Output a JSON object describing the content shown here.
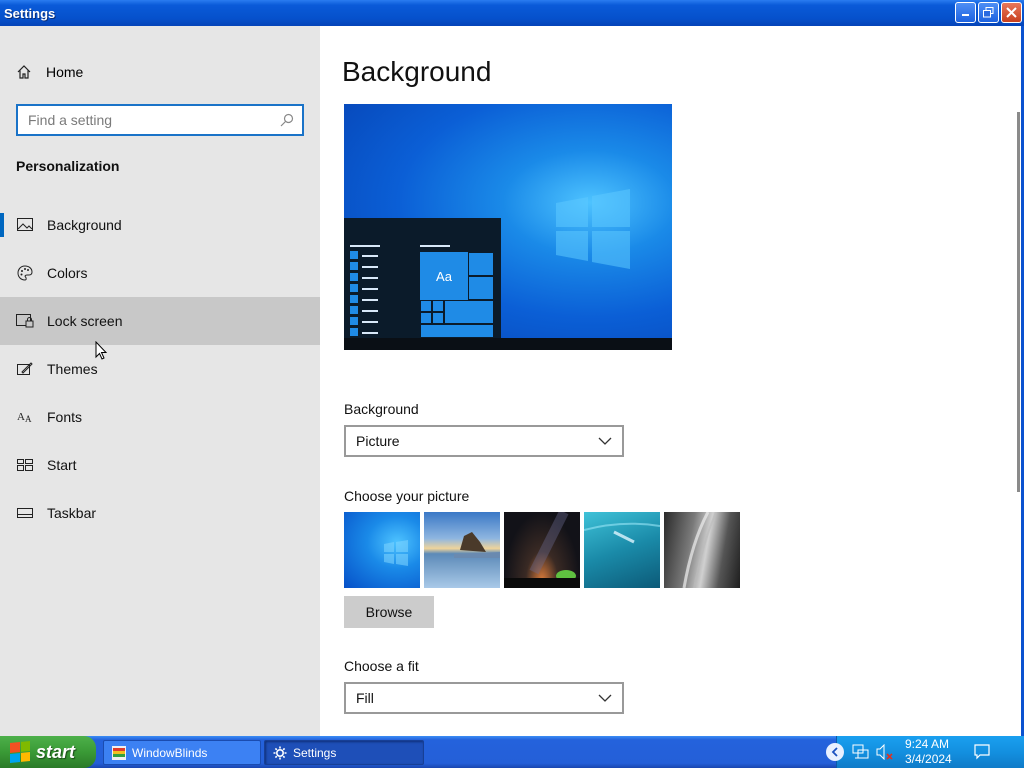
{
  "window": {
    "title": "Settings"
  },
  "sidebar": {
    "home_label": "Home",
    "search_placeholder": "Find a setting",
    "section_title": "Personalization",
    "items": [
      {
        "label": "Background",
        "icon": "picture-icon",
        "selected": true
      },
      {
        "label": "Colors",
        "icon": "palette-icon"
      },
      {
        "label": "Lock screen",
        "icon": "lock-screen-icon",
        "hover": true
      },
      {
        "label": "Themes",
        "icon": "themes-icon"
      },
      {
        "label": "Fonts",
        "icon": "fonts-icon"
      },
      {
        "label": "Start",
        "icon": "start-icon"
      },
      {
        "label": "Taskbar",
        "icon": "taskbar-icon"
      }
    ]
  },
  "main": {
    "page_title": "Background",
    "preview": {
      "tile_text": "Aa"
    },
    "background_label": "Background",
    "background_value": "Picture",
    "choose_picture_label": "Choose your picture",
    "browse_label": "Browse",
    "choose_fit_label": "Choose a fit",
    "fit_value": "Fill"
  },
  "taskbar": {
    "start_label": "start",
    "tasks": [
      {
        "label": "WindowBlinds",
        "icon": "windowblinds-icon"
      },
      {
        "label": "Settings",
        "icon": "gear-icon",
        "active": true
      }
    ],
    "clock_time": "9:24 AM",
    "clock_date": "3/4/2024"
  },
  "colors": {
    "accent": "#0067c0",
    "sidebar_bg": "#e6e6e6",
    "hover_bg": "#c8c8c8"
  }
}
